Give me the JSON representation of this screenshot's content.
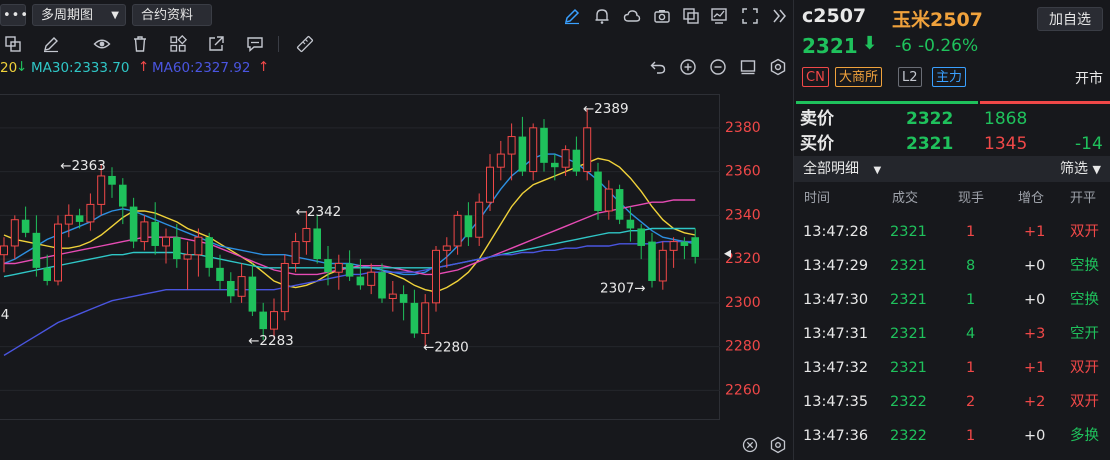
{
  "toolbar": {
    "menu_label": "•••",
    "period_label": "多周期图",
    "contract_info_label": "合约资料"
  },
  "ma": {
    "ma20_partial": "20",
    "ma30_label": "MA30:2333.70",
    "ma60_label": "MA60:2327.92"
  },
  "chart_data": {
    "type": "candlestick",
    "yaxis_ticks": [
      "2380",
      "2360",
      "2340",
      "2320",
      "2300",
      "2280",
      "2260"
    ],
    "ylim": [
      2246,
      2395
    ],
    "last_price_marker": 2322,
    "annotations": [
      {
        "text": "←2363",
        "value": 2363
      },
      {
        "text": "←2342",
        "value": 2342
      },
      {
        "text": "←2389",
        "value": 2389
      },
      {
        "text": "←2283",
        "value": 2283
      },
      {
        "text": "←2280",
        "value": 2280
      },
      {
        "text": "2307→",
        "value": 2307
      },
      {
        "text": "4",
        "value": 2295
      }
    ],
    "candles": [
      {
        "o": 2322,
        "h": 2330,
        "l": 2314,
        "c": 2326
      },
      {
        "o": 2326,
        "h": 2340,
        "l": 2320,
        "c": 2338
      },
      {
        "o": 2338,
        "h": 2344,
        "l": 2330,
        "c": 2332
      },
      {
        "o": 2332,
        "h": 2340,
        "l": 2312,
        "c": 2316
      },
      {
        "o": 2316,
        "h": 2322,
        "l": 2308,
        "c": 2310
      },
      {
        "o": 2310,
        "h": 2340,
        "l": 2308,
        "c": 2336
      },
      {
        "o": 2336,
        "h": 2345,
        "l": 2330,
        "c": 2340
      },
      {
        "o": 2340,
        "h": 2343,
        "l": 2334,
        "c": 2337
      },
      {
        "o": 2337,
        "h": 2350,
        "l": 2333,
        "c": 2345
      },
      {
        "o": 2345,
        "h": 2363,
        "l": 2340,
        "c": 2358
      },
      {
        "o": 2358,
        "h": 2362,
        "l": 2348,
        "c": 2354
      },
      {
        "o": 2354,
        "h": 2357,
        "l": 2336,
        "c": 2344
      },
      {
        "o": 2344,
        "h": 2348,
        "l": 2325,
        "c": 2328
      },
      {
        "o": 2328,
        "h": 2340,
        "l": 2324,
        "c": 2337
      },
      {
        "o": 2337,
        "h": 2346,
        "l": 2322,
        "c": 2326
      },
      {
        "o": 2326,
        "h": 2334,
        "l": 2318,
        "c": 2330
      },
      {
        "o": 2330,
        "h": 2336,
        "l": 2316,
        "c": 2320
      },
      {
        "o": 2320,
        "h": 2328,
        "l": 2306,
        "c": 2322
      },
      {
        "o": 2322,
        "h": 2334,
        "l": 2312,
        "c": 2330
      },
      {
        "o": 2330,
        "h": 2332,
        "l": 2312,
        "c": 2316
      },
      {
        "o": 2316,
        "h": 2322,
        "l": 2306,
        "c": 2310
      },
      {
        "o": 2310,
        "h": 2314,
        "l": 2300,
        "c": 2303
      },
      {
        "o": 2303,
        "h": 2318,
        "l": 2300,
        "c": 2312
      },
      {
        "o": 2312,
        "h": 2318,
        "l": 2294,
        "c": 2296
      },
      {
        "o": 2296,
        "h": 2300,
        "l": 2283,
        "c": 2288
      },
      {
        "o": 2288,
        "h": 2302,
        "l": 2284,
        "c": 2296
      },
      {
        "o": 2296,
        "h": 2322,
        "l": 2292,
        "c": 2318
      },
      {
        "o": 2318,
        "h": 2332,
        "l": 2314,
        "c": 2328
      },
      {
        "o": 2328,
        "h": 2342,
        "l": 2322,
        "c": 2334
      },
      {
        "o": 2334,
        "h": 2340,
        "l": 2318,
        "c": 2320
      },
      {
        "o": 2320,
        "h": 2326,
        "l": 2308,
        "c": 2314
      },
      {
        "o": 2314,
        "h": 2322,
        "l": 2306,
        "c": 2318
      },
      {
        "o": 2318,
        "h": 2324,
        "l": 2310,
        "c": 2312
      },
      {
        "o": 2312,
        "h": 2320,
        "l": 2306,
        "c": 2308
      },
      {
        "o": 2308,
        "h": 2318,
        "l": 2304,
        "c": 2314
      },
      {
        "o": 2314,
        "h": 2318,
        "l": 2300,
        "c": 2302
      },
      {
        "o": 2302,
        "h": 2310,
        "l": 2296,
        "c": 2304
      },
      {
        "o": 2304,
        "h": 2308,
        "l": 2292,
        "c": 2300
      },
      {
        "o": 2300,
        "h": 2306,
        "l": 2284,
        "c": 2286
      },
      {
        "o": 2286,
        "h": 2304,
        "l": 2280,
        "c": 2300
      },
      {
        "o": 2300,
        "h": 2326,
        "l": 2296,
        "c": 2324
      },
      {
        "o": 2324,
        "h": 2330,
        "l": 2316,
        "c": 2326
      },
      {
        "o": 2326,
        "h": 2342,
        "l": 2322,
        "c": 2340
      },
      {
        "o": 2340,
        "h": 2346,
        "l": 2326,
        "c": 2330
      },
      {
        "o": 2330,
        "h": 2350,
        "l": 2326,
        "c": 2346
      },
      {
        "o": 2346,
        "h": 2368,
        "l": 2342,
        "c": 2362
      },
      {
        "o": 2362,
        "h": 2374,
        "l": 2356,
        "c": 2368
      },
      {
        "o": 2368,
        "h": 2382,
        "l": 2356,
        "c": 2376
      },
      {
        "o": 2376,
        "h": 2385,
        "l": 2358,
        "c": 2360
      },
      {
        "o": 2360,
        "h": 2382,
        "l": 2356,
        "c": 2380
      },
      {
        "o": 2380,
        "h": 2384,
        "l": 2360,
        "c": 2364
      },
      {
        "o": 2364,
        "h": 2368,
        "l": 2356,
        "c": 2362
      },
      {
        "o": 2362,
        "h": 2372,
        "l": 2358,
        "c": 2370
      },
      {
        "o": 2370,
        "h": 2376,
        "l": 2358,
        "c": 2360
      },
      {
        "o": 2360,
        "h": 2389,
        "l": 2356,
        "c": 2380
      },
      {
        "o": 2360,
        "h": 2364,
        "l": 2338,
        "c": 2342
      },
      {
        "o": 2342,
        "h": 2356,
        "l": 2338,
        "c": 2352
      },
      {
        "o": 2352,
        "h": 2354,
        "l": 2336,
        "c": 2338
      },
      {
        "o": 2338,
        "h": 2344,
        "l": 2328,
        "c": 2334
      },
      {
        "o": 2334,
        "h": 2336,
        "l": 2320,
        "c": 2326
      },
      {
        "o": 2328,
        "h": 2332,
        "l": 2307,
        "c": 2310
      },
      {
        "o": 2310,
        "h": 2328,
        "l": 2306,
        "c": 2324
      },
      {
        "o": 2324,
        "h": 2330,
        "l": 2316,
        "c": 2328
      },
      {
        "o": 2328,
        "h": 2330,
        "l": 2320,
        "c": 2326
      },
      {
        "o": 2330,
        "h": 2334,
        "l": 2318,
        "c": 2321
      }
    ],
    "series": [
      {
        "color": "#f0d23a",
        "values": [
          2331,
          2329,
          2328,
          2327,
          2326,
          2325,
          2325,
          2326,
          2328,
          2331,
          2335,
          2339,
          2342,
          2342,
          2341,
          2339,
          2337,
          2334,
          2332,
          2330,
          2327,
          2324,
          2321,
          2318,
          2314,
          2310,
          2308,
          2307,
          2308,
          2310,
          2313,
          2315,
          2316,
          2316,
          2316,
          2315,
          2313,
          2311,
          2308,
          2306,
          2305,
          2307,
          2310,
          2314,
          2320,
          2328,
          2336,
          2344,
          2350,
          2354,
          2356,
          2358,
          2360,
          2362,
          2364,
          2366,
          2365,
          2362,
          2357,
          2351,
          2344,
          2338,
          2334,
          2332,
          2331
        ]
      },
      {
        "color": "#2d8fe0",
        "values": [
          2318,
          2320,
          2323,
          2326,
          2329,
          2331,
          2333,
          2335,
          2337,
          2340,
          2342,
          2343,
          2342,
          2340,
          2338,
          2336,
          2334,
          2332,
          2330,
          2328,
          2326,
          2325,
          2324,
          2323,
          2322,
          2322,
          2322,
          2321,
          2320,
          2319,
          2318,
          2318,
          2318,
          2317,
          2316,
          2315,
          2314,
          2313,
          2313,
          2314,
          2317,
          2321,
          2326,
          2332,
          2338,
          2345,
          2352,
          2358,
          2362,
          2366,
          2368,
          2368,
          2366,
          2364,
          2360,
          2356,
          2351,
          2346,
          2341,
          2337,
          2333,
          2330,
          2329,
          2328,
          2327
        ]
      },
      {
        "color": "#e64bb4",
        "values": [
          2318,
          2318,
          2319,
          2320,
          2321,
          2322,
          2323,
          2324,
          2325,
          2326,
          2327,
          2328,
          2329,
          2330,
          2330,
          2330,
          2330,
          2329,
          2328,
          2327,
          2325,
          2323,
          2321,
          2319,
          2317,
          2315,
          2314,
          2313,
          2313,
          2313,
          2314,
          2315,
          2316,
          2317,
          2317,
          2317,
          2316,
          2315,
          2314,
          2313,
          2313,
          2314,
          2315,
          2317,
          2319,
          2321,
          2323,
          2325,
          2327,
          2329,
          2331,
          2333,
          2335,
          2337,
          2339,
          2341,
          2342,
          2343,
          2344,
          2345,
          2346,
          2346,
          2347,
          2347,
          2347
        ]
      },
      {
        "color": "#2fc6c6",
        "values": [
          2312,
          2313,
          2314,
          2315,
          2316,
          2317,
          2318,
          2319,
          2320,
          2321,
          2322,
          2322,
          2323,
          2323,
          2323,
          2323,
          2323,
          2322,
          2322,
          2321,
          2320,
          2319,
          2318,
          2317,
          2316,
          2316,
          2316,
          2316,
          2316,
          2316,
          2316,
          2316,
          2316,
          2316,
          2316,
          2316,
          2316,
          2316,
          2316,
          2316,
          2316,
          2317,
          2318,
          2319,
          2320,
          2321,
          2322,
          2323,
          2324,
          2325,
          2326,
          2327,
          2328,
          2329,
          2330,
          2331,
          2332,
          2332,
          2333,
          2333,
          2334,
          2334,
          2334,
          2334,
          2334
        ]
      },
      {
        "color": "#4a55e0",
        "values": [
          2276,
          2279,
          2282,
          2285,
          2288,
          2291,
          2293,
          2295,
          2297,
          2299,
          2301,
          2302,
          2303,
          2304,
          2305,
          2306,
          2306,
          2306,
          2306,
          2306,
          2306,
          2306,
          2306,
          2306,
          2306,
          2306,
          2307,
          2308,
          2309,
          2310,
          2311,
          2312,
          2313,
          2313,
          2314,
          2314,
          2314,
          2314,
          2314,
          2315,
          2316,
          2317,
          2318,
          2319,
          2320,
          2321,
          2322,
          2322,
          2323,
          2323,
          2324,
          2324,
          2325,
          2325,
          2326,
          2326,
          2326,
          2327,
          2327,
          2327,
          2327,
          2328,
          2328,
          2328,
          2328
        ]
      }
    ]
  },
  "quote": {
    "code": "c2507",
    "name": "玉米2507",
    "add_fav_label": "加自选",
    "price": "2321",
    "change": "-6",
    "change_pct": "-0.26%",
    "tags": [
      "CN",
      "大商所",
      "L2",
      "主力"
    ],
    "status": "开市",
    "ask_label": "卖价",
    "ask_price": "2322",
    "ask_vol": "1868",
    "bid_label": "买价",
    "bid_price": "2321",
    "bid_vol": "1345",
    "bid_change": "-14",
    "detail_label": "全部明细",
    "filter_label": "筛选",
    "columns": [
      "时间",
      "成交",
      "现手",
      "增仓",
      "开平"
    ],
    "trades": [
      {
        "time": "13:47:28",
        "price": "2321",
        "vol": "1",
        "oi": "+1",
        "type": "双开"
      },
      {
        "time": "13:47:29",
        "price": "2321",
        "vol": "8",
        "oi": "+0",
        "type": "空换"
      },
      {
        "time": "13:47:30",
        "price": "2321",
        "vol": "1",
        "oi": "+0",
        "type": "空换"
      },
      {
        "time": "13:47:31",
        "price": "2321",
        "vol": "4",
        "oi": "+3",
        "type": "空开"
      },
      {
        "time": "13:47:32",
        "price": "2321",
        "vol": "1",
        "oi": "+1",
        "type": "双开"
      },
      {
        "time": "13:47:35",
        "price": "2322",
        "vol": "2",
        "oi": "+2",
        "type": "双开"
      },
      {
        "time": "13:47:36",
        "price": "2322",
        "vol": "1",
        "oi": "+0",
        "type": "多换"
      }
    ]
  }
}
